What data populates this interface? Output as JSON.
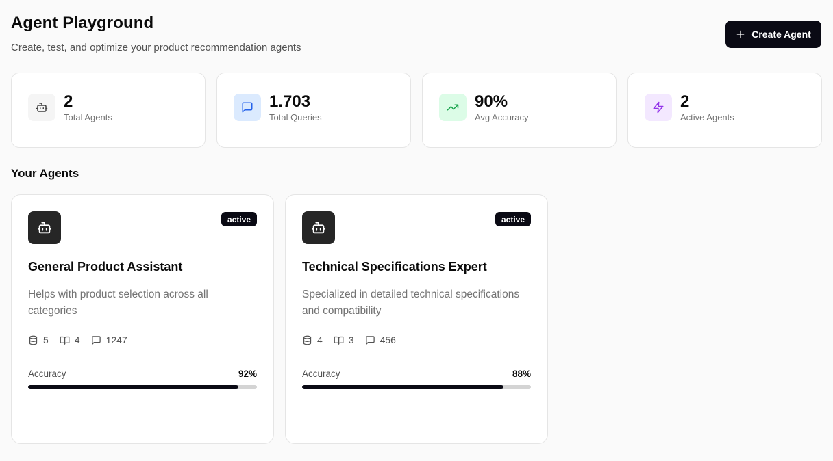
{
  "header": {
    "title": "Agent Playground",
    "subtitle": "Create, test, and optimize your product recommendation agents",
    "create_button_label": "Create Agent"
  },
  "stats": [
    {
      "value": "2",
      "label": "Total Agents",
      "icon": "bot-icon",
      "color": "#525252",
      "bg": "#f5f5f5"
    },
    {
      "value": "1.703",
      "label": "Total Queries",
      "icon": "message-square-icon",
      "color": "#2563eb",
      "bg": "#dbeafe"
    },
    {
      "value": "90%",
      "label": "Avg Accuracy",
      "icon": "trending-up-icon",
      "color": "#16a34a",
      "bg": "#dcfce7"
    },
    {
      "value": "2",
      "label": "Active Agents",
      "icon": "zap-icon",
      "color": "#9333ea",
      "bg": "#f3e8ff"
    }
  ],
  "section_title": "Your Agents",
  "agents": [
    {
      "name": "General Product Assistant",
      "status": "active",
      "description": "Helps with product selection across all categories",
      "data_sources": "5",
      "knowledge": "4",
      "queries": "1247",
      "accuracy_label": "Accuracy",
      "accuracy": "92%",
      "accuracy_value": 0.92
    },
    {
      "name": "Technical Specifications Expert",
      "status": "active",
      "description": "Specialized in detailed technical specifications and compatibility",
      "data_sources": "4",
      "knowledge": "3",
      "queries": "456",
      "accuracy_label": "Accuracy",
      "accuracy": "88%",
      "accuracy_value": 0.88
    }
  ]
}
